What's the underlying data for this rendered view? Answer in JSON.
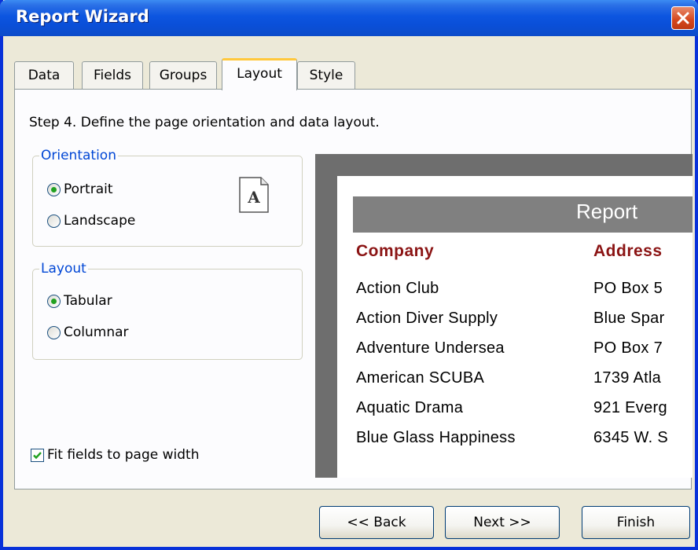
{
  "window": {
    "title": "Report Wizard"
  },
  "tabs": [
    {
      "label": "Data"
    },
    {
      "label": "Fields"
    },
    {
      "label": "Groups"
    },
    {
      "label": "Layout"
    },
    {
      "label": "Style"
    }
  ],
  "active_tab": "Layout",
  "step_text": "Step 4. Define the page orientation and data layout.",
  "orientation": {
    "label": "Orientation",
    "options": [
      {
        "label": "Portrait",
        "selected": true
      },
      {
        "label": "Landscape",
        "selected": false
      }
    ],
    "page_icon_letter": "A"
  },
  "layout": {
    "label": "Layout",
    "options": [
      {
        "label": "Tabular",
        "selected": true
      },
      {
        "label": "Columnar",
        "selected": false
      }
    ]
  },
  "fit_fields": {
    "label": "Fit fields to page width",
    "checked": true
  },
  "preview": {
    "report_title": "Report",
    "columns": [
      "Company",
      "Address"
    ],
    "rows": [
      [
        "Action Club",
        "PO Box 5"
      ],
      [
        "Action Diver Supply",
        "Blue Spar"
      ],
      [
        "Adventure Undersea",
        "PO Box 7"
      ],
      [
        "American SCUBA",
        "1739 Atla"
      ],
      [
        "Aquatic Drama",
        "921 Everg"
      ],
      [
        "Blue Glass Happiness",
        "6345 W. S"
      ]
    ]
  },
  "buttons": {
    "back": "<< Back",
    "next": "Next >>",
    "finish": "Finish"
  },
  "colors": {
    "titlebar": "#0a4fd8",
    "group_label": "#0046d5",
    "column_header": "#8b1414",
    "active_tab_accent": "#ffc83c"
  }
}
